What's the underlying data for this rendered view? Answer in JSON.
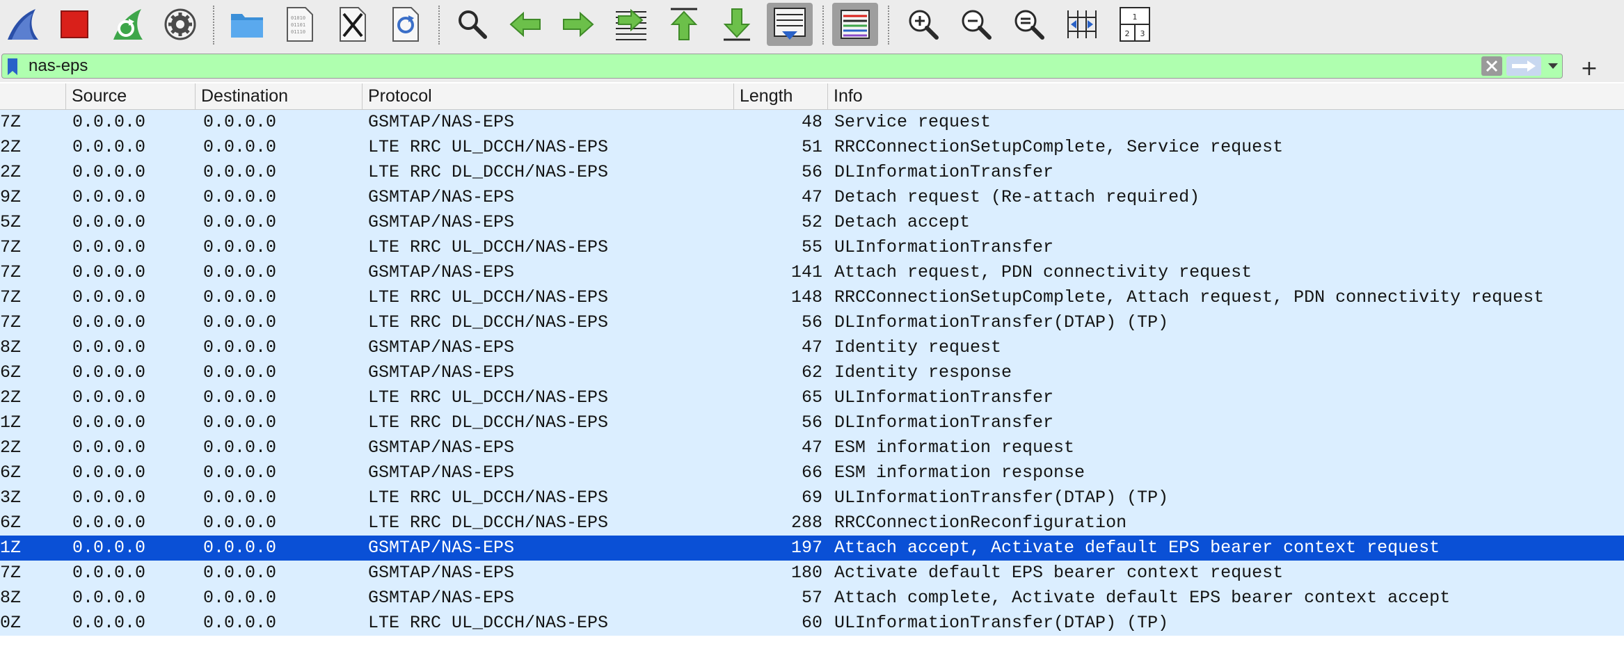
{
  "toolbar": {
    "buttons": [
      {
        "name": "start-capture",
        "icon": "shark-fin-icon"
      },
      {
        "name": "stop-capture",
        "icon": "stop-square-icon"
      },
      {
        "name": "restart-capture",
        "icon": "restart-fin-icon"
      },
      {
        "name": "capture-options",
        "icon": "gear-icon"
      },
      {
        "name": "open-file",
        "icon": "folder-icon"
      },
      {
        "name": "save-file",
        "icon": "binary-file-icon"
      },
      {
        "name": "close-file",
        "icon": "close-file-icon"
      },
      {
        "name": "reload-file",
        "icon": "reload-file-icon"
      },
      {
        "name": "find-packet",
        "icon": "magnifier-icon"
      },
      {
        "name": "go-back",
        "icon": "arrow-left-icon"
      },
      {
        "name": "go-forward",
        "icon": "arrow-right-icon"
      },
      {
        "name": "go-to-packet",
        "icon": "jump-to-packet-icon"
      },
      {
        "name": "go-first",
        "icon": "first-packet-icon"
      },
      {
        "name": "go-last",
        "icon": "last-packet-icon"
      },
      {
        "name": "auto-scroll",
        "icon": "autoscroll-icon",
        "active": true
      },
      {
        "name": "colorize",
        "icon": "colorize-lines-icon",
        "active": true
      },
      {
        "name": "zoom-in",
        "icon": "zoom-in-icon"
      },
      {
        "name": "zoom-out",
        "icon": "zoom-out-icon"
      },
      {
        "name": "normal-size",
        "icon": "zoom-reset-icon"
      },
      {
        "name": "resize-columns",
        "icon": "resize-columns-icon"
      },
      {
        "name": "layout",
        "icon": "pane-layout-icon",
        "digits": [
          "1",
          "2",
          "3"
        ]
      }
    ]
  },
  "filter": {
    "value": "nas-eps",
    "background": "#afffaf",
    "add_label": "+"
  },
  "columns": {
    "source": "Source",
    "destination": "Destination",
    "protocol": "Protocol",
    "length": "Length",
    "info": "Info"
  },
  "colors": {
    "row_bg": "#dbeeff",
    "selected_bg": "#0a50d6"
  },
  "packets": [
    {
      "time": "7Z",
      "source": "0.0.0.0",
      "destination": "0.0.0.0",
      "protocol": "GSMTAP/NAS-EPS",
      "length": "48",
      "info": "Service request"
    },
    {
      "time": "2Z",
      "source": "0.0.0.0",
      "destination": "0.0.0.0",
      "protocol": "LTE RRC UL_DCCH/NAS-EPS",
      "length": "51",
      "info": "RRCConnectionSetupComplete, Service request"
    },
    {
      "time": "2Z",
      "source": "0.0.0.0",
      "destination": "0.0.0.0",
      "protocol": "LTE RRC DL_DCCH/NAS-EPS",
      "length": "56",
      "info": "DLInformationTransfer"
    },
    {
      "time": "9Z",
      "source": "0.0.0.0",
      "destination": "0.0.0.0",
      "protocol": "GSMTAP/NAS-EPS",
      "length": "47",
      "info": "Detach request (Re-attach required)"
    },
    {
      "time": "5Z",
      "source": "0.0.0.0",
      "destination": "0.0.0.0",
      "protocol": "GSMTAP/NAS-EPS",
      "length": "52",
      "info": "Detach accept"
    },
    {
      "time": "7Z",
      "source": "0.0.0.0",
      "destination": "0.0.0.0",
      "protocol": "LTE RRC UL_DCCH/NAS-EPS",
      "length": "55",
      "info": "ULInformationTransfer"
    },
    {
      "time": "7Z",
      "source": "0.0.0.0",
      "destination": "0.0.0.0",
      "protocol": "GSMTAP/NAS-EPS",
      "length": "141",
      "info": "Attach request, PDN connectivity request"
    },
    {
      "time": "7Z",
      "source": "0.0.0.0",
      "destination": "0.0.0.0",
      "protocol": "LTE RRC UL_DCCH/NAS-EPS",
      "length": "148",
      "info": "RRCConnectionSetupComplete, Attach request, PDN connectivity request"
    },
    {
      "time": "7Z",
      "source": "0.0.0.0",
      "destination": "0.0.0.0",
      "protocol": "LTE RRC DL_DCCH/NAS-EPS",
      "length": "56",
      "info": "DLInformationTransfer(DTAP) (TP)"
    },
    {
      "time": "8Z",
      "source": "0.0.0.0",
      "destination": "0.0.0.0",
      "protocol": "GSMTAP/NAS-EPS",
      "length": "47",
      "info": "Identity request"
    },
    {
      "time": "6Z",
      "source": "0.0.0.0",
      "destination": "0.0.0.0",
      "protocol": "GSMTAP/NAS-EPS",
      "length": "62",
      "info": "Identity response"
    },
    {
      "time": "2Z",
      "source": "0.0.0.0",
      "destination": "0.0.0.0",
      "protocol": "LTE RRC UL_DCCH/NAS-EPS",
      "length": "65",
      "info": "ULInformationTransfer"
    },
    {
      "time": "1Z",
      "source": "0.0.0.0",
      "destination": "0.0.0.0",
      "protocol": "LTE RRC DL_DCCH/NAS-EPS",
      "length": "56",
      "info": "DLInformationTransfer"
    },
    {
      "time": "2Z",
      "source": "0.0.0.0",
      "destination": "0.0.0.0",
      "protocol": "GSMTAP/NAS-EPS",
      "length": "47",
      "info": "ESM information request"
    },
    {
      "time": "6Z",
      "source": "0.0.0.0",
      "destination": "0.0.0.0",
      "protocol": "GSMTAP/NAS-EPS",
      "length": "66",
      "info": "ESM information response"
    },
    {
      "time": "3Z",
      "source": "0.0.0.0",
      "destination": "0.0.0.0",
      "protocol": "LTE RRC UL_DCCH/NAS-EPS",
      "length": "69",
      "info": "ULInformationTransfer(DTAP) (TP)"
    },
    {
      "time": "6Z",
      "source": "0.0.0.0",
      "destination": "0.0.0.0",
      "protocol": "LTE RRC DL_DCCH/NAS-EPS",
      "length": "288",
      "info": "RRCConnectionReconfiguration"
    },
    {
      "time": "1Z",
      "source": "0.0.0.0",
      "destination": "0.0.0.0",
      "protocol": "GSMTAP/NAS-EPS",
      "length": "197",
      "info": "Attach accept, Activate default EPS bearer context request",
      "selected": true
    },
    {
      "time": "7Z",
      "source": "0.0.0.0",
      "destination": "0.0.0.0",
      "protocol": "GSMTAP/NAS-EPS",
      "length": "180",
      "info": "Activate default EPS bearer context request"
    },
    {
      "time": "8Z",
      "source": "0.0.0.0",
      "destination": "0.0.0.0",
      "protocol": "GSMTAP/NAS-EPS",
      "length": "57",
      "info": "Attach complete, Activate default EPS bearer context accept"
    },
    {
      "time": "0Z",
      "source": "0.0.0.0",
      "destination": "0.0.0.0",
      "protocol": "LTE RRC UL_DCCH/NAS-EPS",
      "length": "60",
      "info": "ULInformationTransfer(DTAP) (TP)"
    }
  ]
}
